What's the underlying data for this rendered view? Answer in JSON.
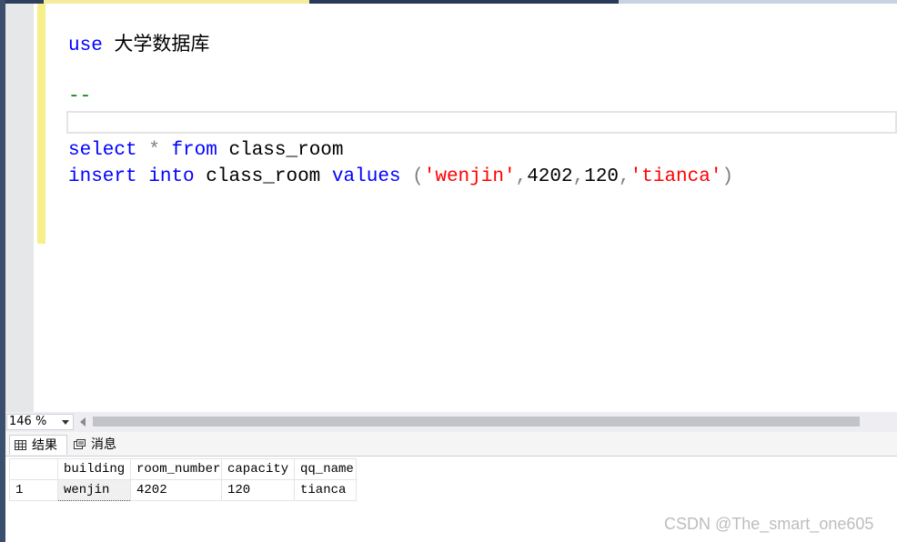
{
  "editor": {
    "lines": {
      "use_kw": "use",
      "use_db": "大学数据库",
      "comment": "--",
      "select_kw": "select",
      "star": "*",
      "from_kw": "from",
      "select_table": "class_room",
      "insert_kw": "insert",
      "into_kw": "into",
      "insert_table": "class_room",
      "values_kw": "values",
      "open_paren": "(",
      "val1": "'wenjin'",
      "comma1": ",",
      "val2": "4202",
      "comma2": ",",
      "val3": "120",
      "comma3": ",",
      "val4": "'tianca'",
      "close_paren": ")"
    }
  },
  "statusbar": {
    "zoom": "146 %"
  },
  "results": {
    "tabs": {
      "results_label": "结果",
      "messages_label": "消息"
    },
    "columns": [
      "building",
      "room_number",
      "capacity",
      "qq_name"
    ],
    "rows": [
      {
        "rownum": "1",
        "cells": [
          "wenjin",
          "4202",
          "120",
          "tianca"
        ]
      }
    ]
  },
  "watermark": "CSDN @The_smart_one605",
  "colors": {
    "keyword": "#0000ff",
    "string": "#ff0000",
    "operator": "#808080",
    "comment": "#008000",
    "change_marker": "#f7ef8a"
  }
}
